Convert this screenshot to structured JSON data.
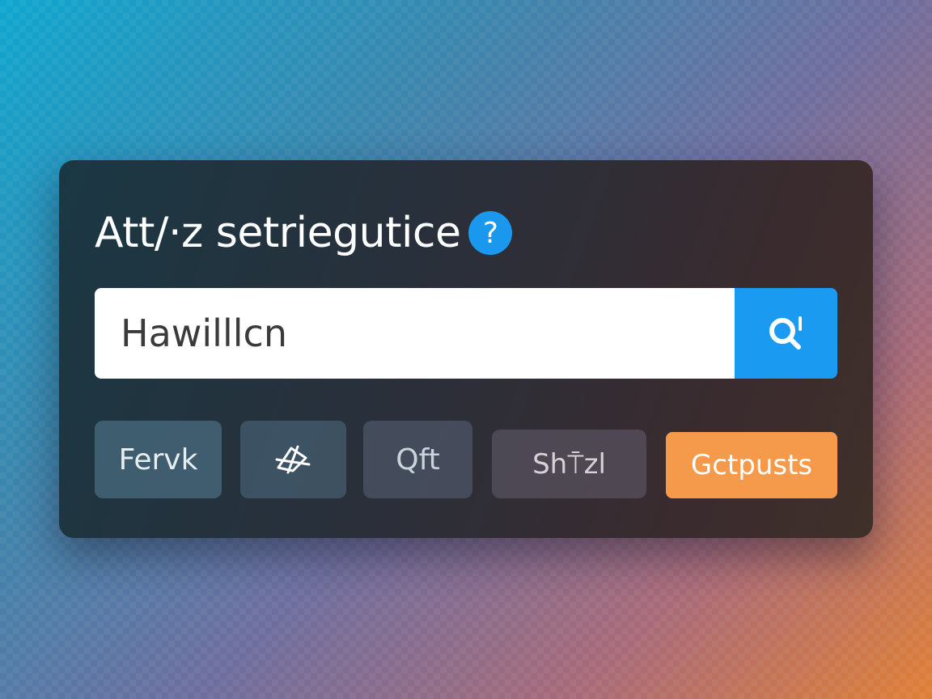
{
  "panel": {
    "title": "Att/·z setriegutice",
    "help_glyph": "?"
  },
  "search": {
    "value": "Hawilllcn",
    "button_icon": "search-icon"
  },
  "actions": [
    {
      "label": "Fervk"
    },
    {
      "label": "",
      "icon": "crossed-shapes-icon"
    },
    {
      "label": "Qft"
    },
    {
      "label": "Sh⍑zl"
    },
    {
      "label": "Gctpusts"
    }
  ],
  "colors": {
    "accent_blue": "#1a9af0",
    "cta_orange": "#f59a4a",
    "card_dark": "#2a2f3a"
  }
}
